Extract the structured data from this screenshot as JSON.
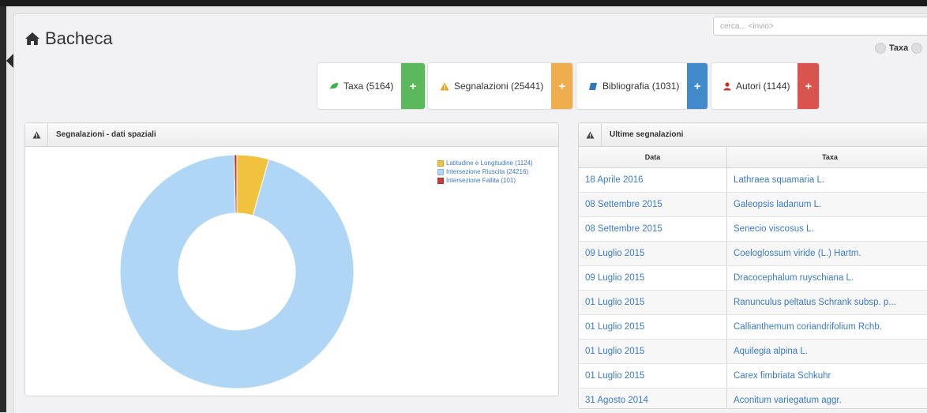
{
  "page": {
    "title": "Bacheca"
  },
  "search": {
    "placeholder": "cerca... <invio>"
  },
  "filter": {
    "label": "Taxa"
  },
  "stats": [
    {
      "label": "Taxa (5164)",
      "icon": "leaf-icon",
      "icon_color": "#3cb24a",
      "plus_color": "#5cb85c"
    },
    {
      "label": "Segnalazioni (25441)",
      "icon": "warning-icon",
      "icon_color": "#e8a11c",
      "plus_color": "#f0ad4e"
    },
    {
      "label": "Bibliografia (1031)",
      "icon": "book-icon",
      "icon_color": "#2f78c4",
      "plus_color": "#428bca"
    },
    {
      "label": "Autori (1144)",
      "icon": "user-icon",
      "icon_color": "#c9302c",
      "plus_color": "#d9534f"
    }
  ],
  "chart_panel": {
    "title": "Segnalazioni - dati spaziali"
  },
  "chart_data": {
    "type": "pie",
    "donut": true,
    "title": "",
    "series": [
      {
        "name": "Latitudine e Longitudine (1124)",
        "value": 1124,
        "color": "#f0c23e"
      },
      {
        "name": "Intersezione Riuscita (24216)",
        "value": 24216,
        "color": "#b0d6f5"
      },
      {
        "name": "Intersezione Fallita (101)",
        "value": 101,
        "color": "#cb3a3a"
      }
    ],
    "legend_position": "top-right"
  },
  "table_panel": {
    "title": "Ultime segnalazioni",
    "columns": [
      "Data",
      "Taxa"
    ],
    "rows": [
      [
        "18 Aprile 2016",
        "Lathraea squamaria L."
      ],
      [
        "08 Settembre 2015",
        "Galeopsis ladanum L."
      ],
      [
        "08 Settembre 2015",
        "Senecio viscosus L."
      ],
      [
        "09 Luglio 2015",
        "Coeloglossum viride (L.) Hartm."
      ],
      [
        "09 Luglio 2015",
        "Dracocephalum ruyschiana L."
      ],
      [
        "01 Luglio 2015",
        "Ranunculus peltatus Schrank subsp. p..."
      ],
      [
        "01 Luglio 2015",
        "Callianthemum coriandrifolium Rchb."
      ],
      [
        "01 Luglio 2015",
        "Aquilegia alpina L."
      ],
      [
        "01 Luglio 2015",
        "Carex fimbriata Schkuhr"
      ],
      [
        "31 Agosto 2014",
        "Aconitum variegatum aggr."
      ]
    ]
  }
}
